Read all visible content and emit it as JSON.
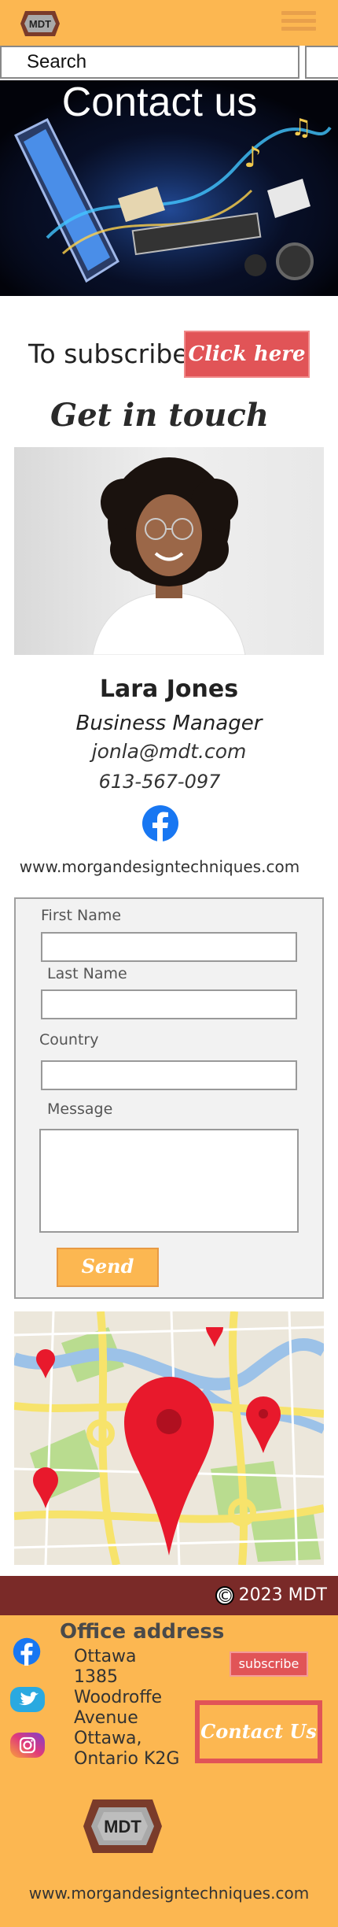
{
  "header": {
    "logo_text": "MDT",
    "menu_icon": "hamburger-icon"
  },
  "search": {
    "placeholder": "Search"
  },
  "hero": {
    "title": "Contact us"
  },
  "subscribe": {
    "text": "To subscribe",
    "button_label": "Click here !"
  },
  "section": {
    "heading": "Get in touch"
  },
  "profile": {
    "name": "Lara Jones",
    "role": "Business Manager",
    "email": "jonla@mdt.com",
    "phone": "613-567-097",
    "website": "www.morgandesigntechniques.com",
    "social_icon": "facebook-icon"
  },
  "form": {
    "first_name_label": "First Name",
    "last_name_label": "Last Name",
    "country_label": "Country",
    "message_label": "Message",
    "send_label": "Send"
  },
  "footer": {
    "copyright": "2023 MDT",
    "copyright_symbol": "©",
    "office_heading": "Office address",
    "address_lines": [
      "Ottawa",
      "1385",
      "Woodroffe",
      "Avenue",
      "Ottawa,",
      "Ontario K2G"
    ],
    "subscribe_label": "subscribe",
    "contact_label": "Contact Us",
    "logo_text": "MDT",
    "website": "www.morgandesigntechniques.com",
    "social_icons": [
      "facebook-icon",
      "twitter-icon",
      "instagram-icon"
    ]
  },
  "colors": {
    "brand_orange": "#fcb751",
    "accent_red": "#e15457",
    "footer_bar": "#7a2a28"
  }
}
